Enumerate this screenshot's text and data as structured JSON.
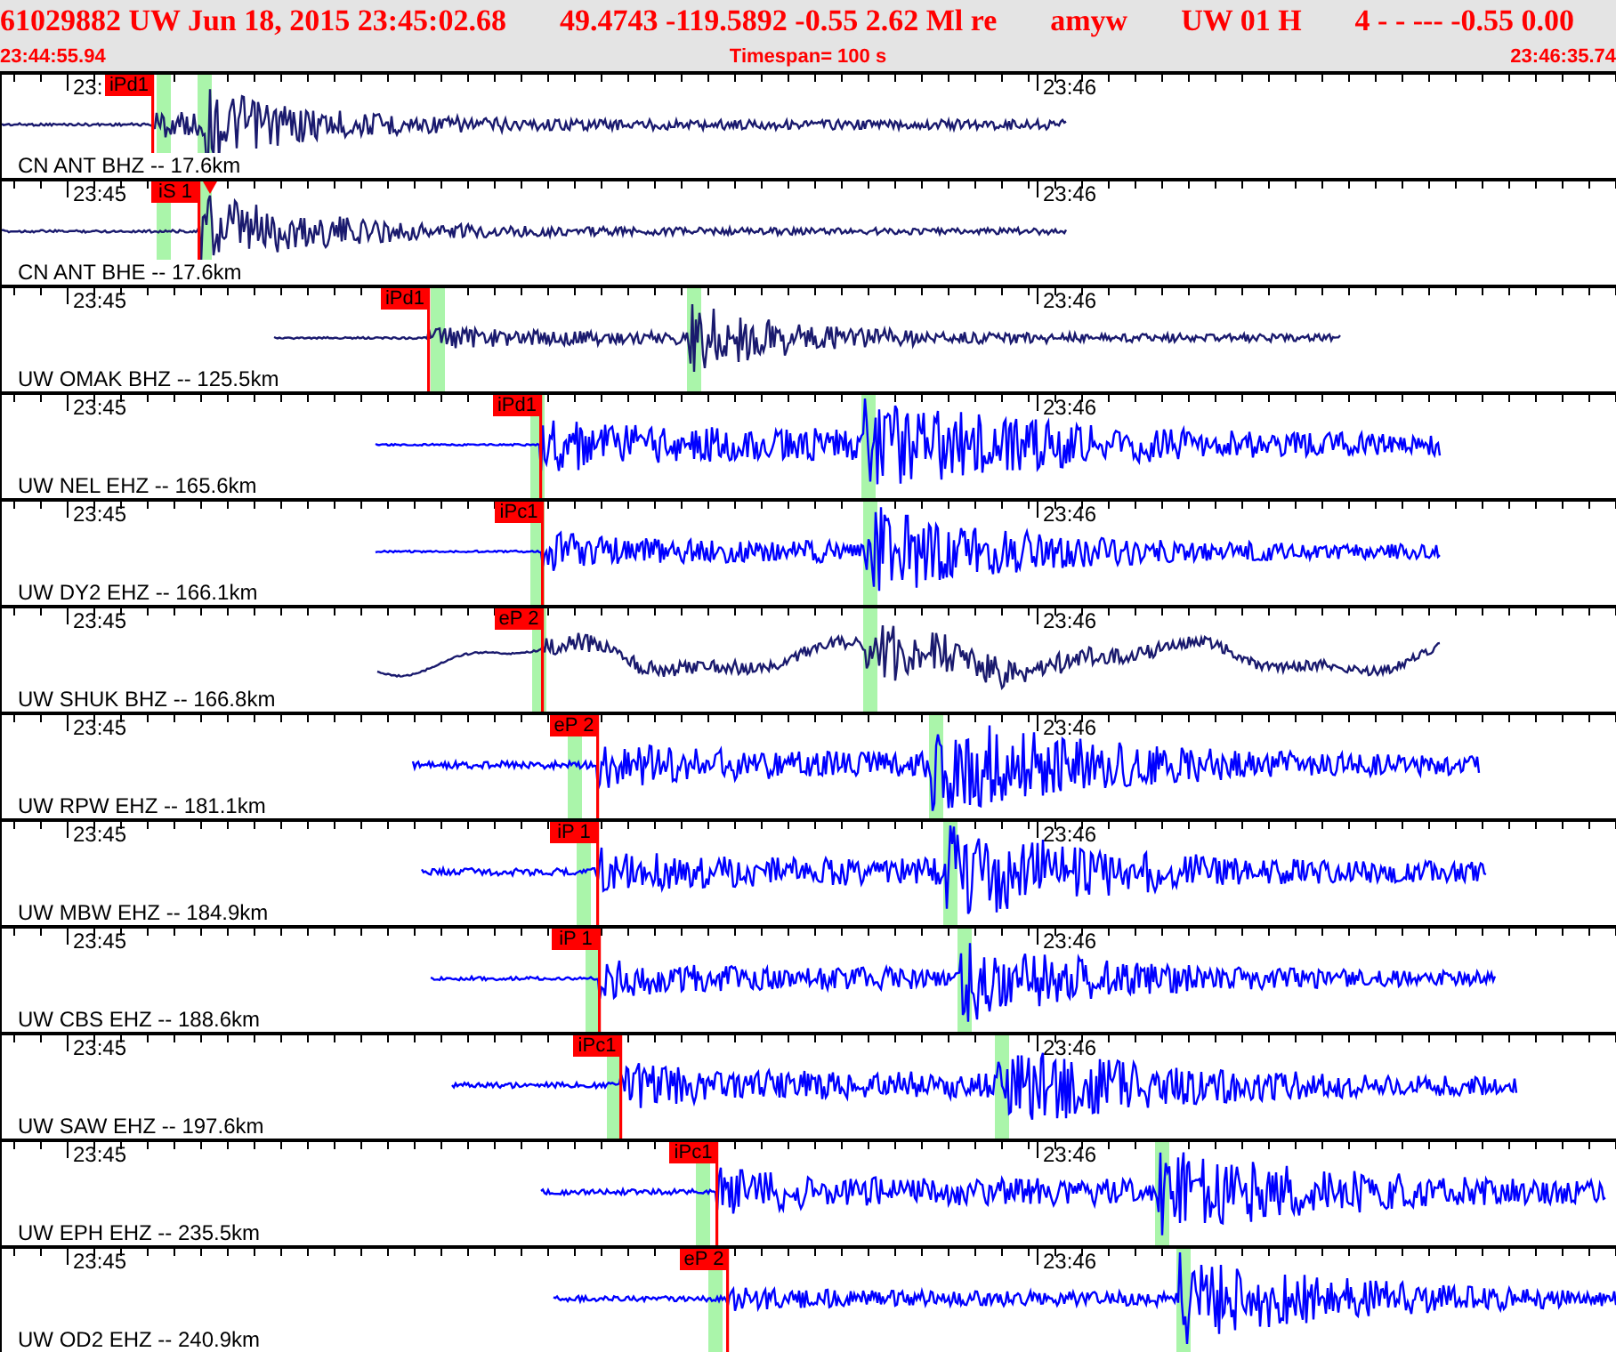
{
  "header": {
    "event_fields": [
      "61029882 UW Jun 18, 2015 23:45:02.68",
      "49.4743 -119.5892 -0.55 2.62 Ml re",
      "amyw",
      "UW 01 H",
      "4  -   - --- -0.55 0.00"
    ],
    "start_time": "23:44:55.94",
    "timespan": "Timespan= 100 s",
    "end_time": "23:46:35.74"
  },
  "channels": [
    {
      "label": "CN ANT BHZ -- 17.6km",
      "time_marks": [
        "23:",
        "23:46"
      ],
      "pick": "iPd1",
      "marker": false,
      "color": "#1a1a6e"
    },
    {
      "label": "CN ANT BHE -- 17.6km",
      "time_marks": [
        "23:45",
        "23:46"
      ],
      "pick": "iS 1",
      "marker": true,
      "color": "#1a1a6e"
    },
    {
      "label": "UW OMAK BHZ -- 125.5km",
      "time_marks": [
        "23:45",
        "23:46"
      ],
      "pick": "iPd1",
      "marker": false,
      "color": "#1a1a6e"
    },
    {
      "label": "UW NEL EHZ -- 165.6km",
      "time_marks": [
        "23:45",
        "23:46"
      ],
      "pick": "iPd1",
      "marker": false,
      "color": "#0000ff"
    },
    {
      "label": "UW DY2 EHZ -- 166.1km",
      "time_marks": [
        "23:45",
        "23:46"
      ],
      "pick": "iPc1",
      "marker": false,
      "color": "#0000ff"
    },
    {
      "label": "UW SHUK BHZ -- 166.8km",
      "time_marks": [
        "23:45",
        "23:46"
      ],
      "pick": "eP 2",
      "marker": false,
      "color": "#1a1a6e"
    },
    {
      "label": "UW RPW EHZ -- 181.1km",
      "time_marks": [
        "23:45",
        "23:46"
      ],
      "pick": "eP 2",
      "marker": false,
      "color": "#0000ff"
    },
    {
      "label": "UW MBW EHZ -- 184.9km",
      "time_marks": [
        "23:45",
        "23:46"
      ],
      "pick": "iP 1",
      "marker": false,
      "color": "#0000ff"
    },
    {
      "label": "UW CBS EHZ -- 188.6km",
      "time_marks": [
        "23:45",
        "23:46"
      ],
      "pick": "iP 1",
      "marker": false,
      "color": "#0000ff"
    },
    {
      "label": "UW SAW EHZ -- 197.6km",
      "time_marks": [
        "23:45",
        "23:46"
      ],
      "pick": "iPc1",
      "marker": false,
      "color": "#0000ff"
    },
    {
      "label": "UW EPH EHZ -- 235.5km",
      "time_marks": [
        "23:45",
        "23:46"
      ],
      "pick": "iPc1",
      "marker": false,
      "color": "#0000ff"
    },
    {
      "label": "UW OD2 EHZ -- 240.9km",
      "time_marks": [
        "23:45",
        "23:46"
      ],
      "pick": "eP 2",
      "marker": false,
      "color": "#0000ff"
    }
  ]
}
